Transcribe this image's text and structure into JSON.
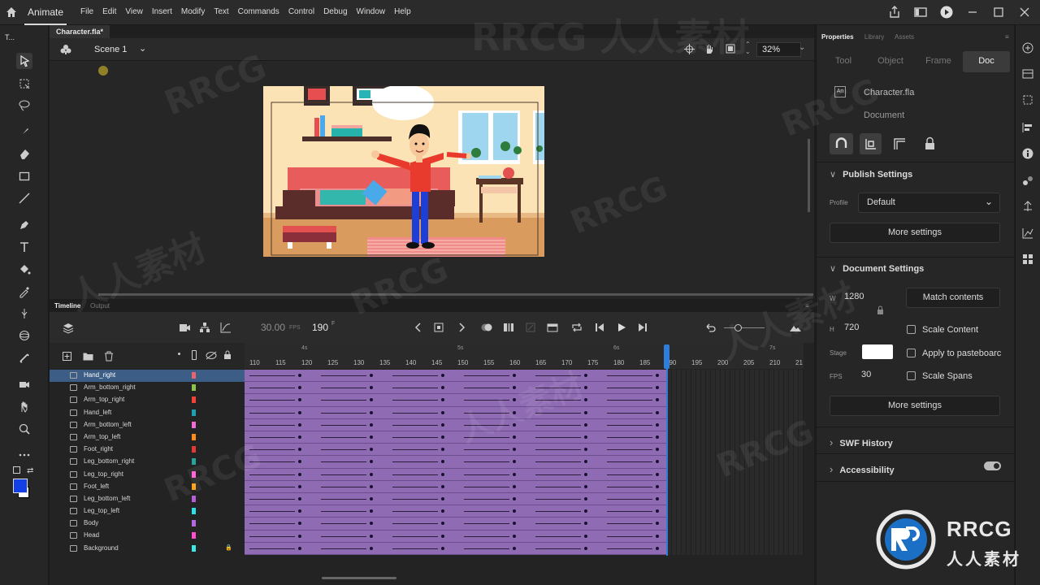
{
  "app": {
    "name": "Animate"
  },
  "menu": [
    "File",
    "Edit",
    "View",
    "Insert",
    "Modify",
    "Text",
    "Commands",
    "Control",
    "Debug",
    "Window",
    "Help"
  ],
  "tools_panel": {
    "header": "T..."
  },
  "document": {
    "tab": "Character.fla*",
    "scene": "Scene 1",
    "zoom": "32%"
  },
  "timeline": {
    "tabs": [
      "Timeline",
      "Output"
    ],
    "fps": "30.00",
    "fps_unit": "FPS",
    "current_frame": "190",
    "frame_unit": "F",
    "ruler_numbers": [
      "110",
      "115",
      "120",
      "125",
      "130",
      "135",
      "140",
      "145",
      "150",
      "155",
      "160",
      "165",
      "170",
      "175",
      "180",
      "185",
      "190",
      "195",
      "200",
      "205",
      "210",
      "21"
    ],
    "ruler_seconds": [
      "4s",
      "5s",
      "6s",
      "7s"
    ],
    "layers": [
      {
        "name": "Hand_right",
        "color": "#e8646e",
        "selected": true
      },
      {
        "name": "Arm_bottom_right",
        "color": "#8bc34a"
      },
      {
        "name": "Arm_top_right",
        "color": "#f44336"
      },
      {
        "name": "Hand_left",
        "color": "#1e9fb4"
      },
      {
        "name": "Arm_bottom_left",
        "color": "#f06bd8"
      },
      {
        "name": "Arm_top_left",
        "color": "#ff8c1a"
      },
      {
        "name": "Foot_right",
        "color": "#e53935"
      },
      {
        "name": "Leg_bottom_right",
        "color": "#26a69a"
      },
      {
        "name": "Leg_top_right",
        "color": "#ff5cd6"
      },
      {
        "name": "Foot_left",
        "color": "#ff9f1a"
      },
      {
        "name": "Leg_bottom_left",
        "color": "#b55fd6"
      },
      {
        "name": "Leg_top_left",
        "color": "#2de0e8"
      },
      {
        "name": "Body",
        "color": "#b468e0"
      },
      {
        "name": "Head",
        "color": "#ff4fd0"
      },
      {
        "name": "Background",
        "color": "#3ee6e6",
        "locked": true
      }
    ]
  },
  "properties": {
    "panel_tabs": [
      "Properties",
      "Library",
      "Assets"
    ],
    "segments": [
      "Tool",
      "Object",
      "Frame",
      "Doc"
    ],
    "active_segment": "Doc",
    "doc_name": "Character.fla",
    "doc_type": "Document",
    "publish": {
      "title": "Publish Settings",
      "profile_label": "Profile",
      "profile": "Default",
      "more": "More settings"
    },
    "docset": {
      "title": "Document Settings",
      "w_label": "W",
      "width": "1280",
      "h_label": "H",
      "height": "720",
      "match": "Match contents",
      "scale_content": "Scale Content",
      "apply_pasteboard": "Apply to pasteboarc",
      "stage_label": "Stage",
      "stage_color": "#ffffff",
      "fps_label": "FPS",
      "fps": "30",
      "scale_spans": "Scale Spans",
      "more": "More settings"
    },
    "swf_history": "SWF History",
    "accessibility": "Accessibility"
  },
  "watermark": {
    "brand": "RRCG",
    "cn": "人人素材"
  }
}
